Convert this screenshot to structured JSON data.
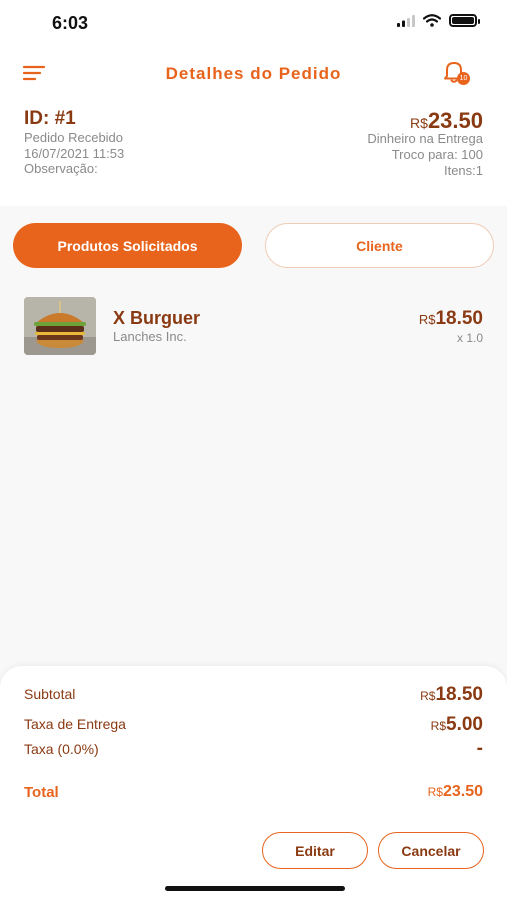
{
  "status_bar": {
    "time": "6:03"
  },
  "header": {
    "title": "Detalhes do Pedido",
    "notification_count": "10"
  },
  "order": {
    "id": "ID: #1",
    "status": "Pedido Recebido",
    "datetime": "16/07/2021 11:53",
    "observation_label": "Observação:",
    "total_currency": "R$",
    "total_amount": "23.50",
    "payment_method": "Dinheiro na Entrega",
    "change_for": "Troco para: 100",
    "items_count": "Itens:1"
  },
  "tabs": [
    {
      "label": "Produtos Solicitados",
      "active": true
    },
    {
      "label": "Cliente",
      "active": false
    }
  ],
  "products": [
    {
      "name": "X Burguer",
      "vendor": "Lanches Inc.",
      "currency": "R$",
      "price": "18.50",
      "quantity": "x 1.0",
      "icon": "burger-photo"
    }
  ],
  "summary": {
    "subtotal_label": "Subtotal",
    "subtotal_currency": "R$",
    "subtotal_amount": "18.50",
    "delivery_label": "Taxa de Entrega",
    "delivery_currency": "R$",
    "delivery_amount": "5.00",
    "tax_label": "Taxa (0.0%)",
    "tax_value": "-",
    "total_label": "Total",
    "total_currency": "R$",
    "total_amount": "23.50"
  },
  "actions": {
    "edit_label": "Editar",
    "cancel_label": "Cancelar"
  },
  "colors": {
    "accent": "#e8641d",
    "text_dark": "#8a3a12",
    "text_muted": "#8a8a8a",
    "background": "#f8f8f8"
  }
}
